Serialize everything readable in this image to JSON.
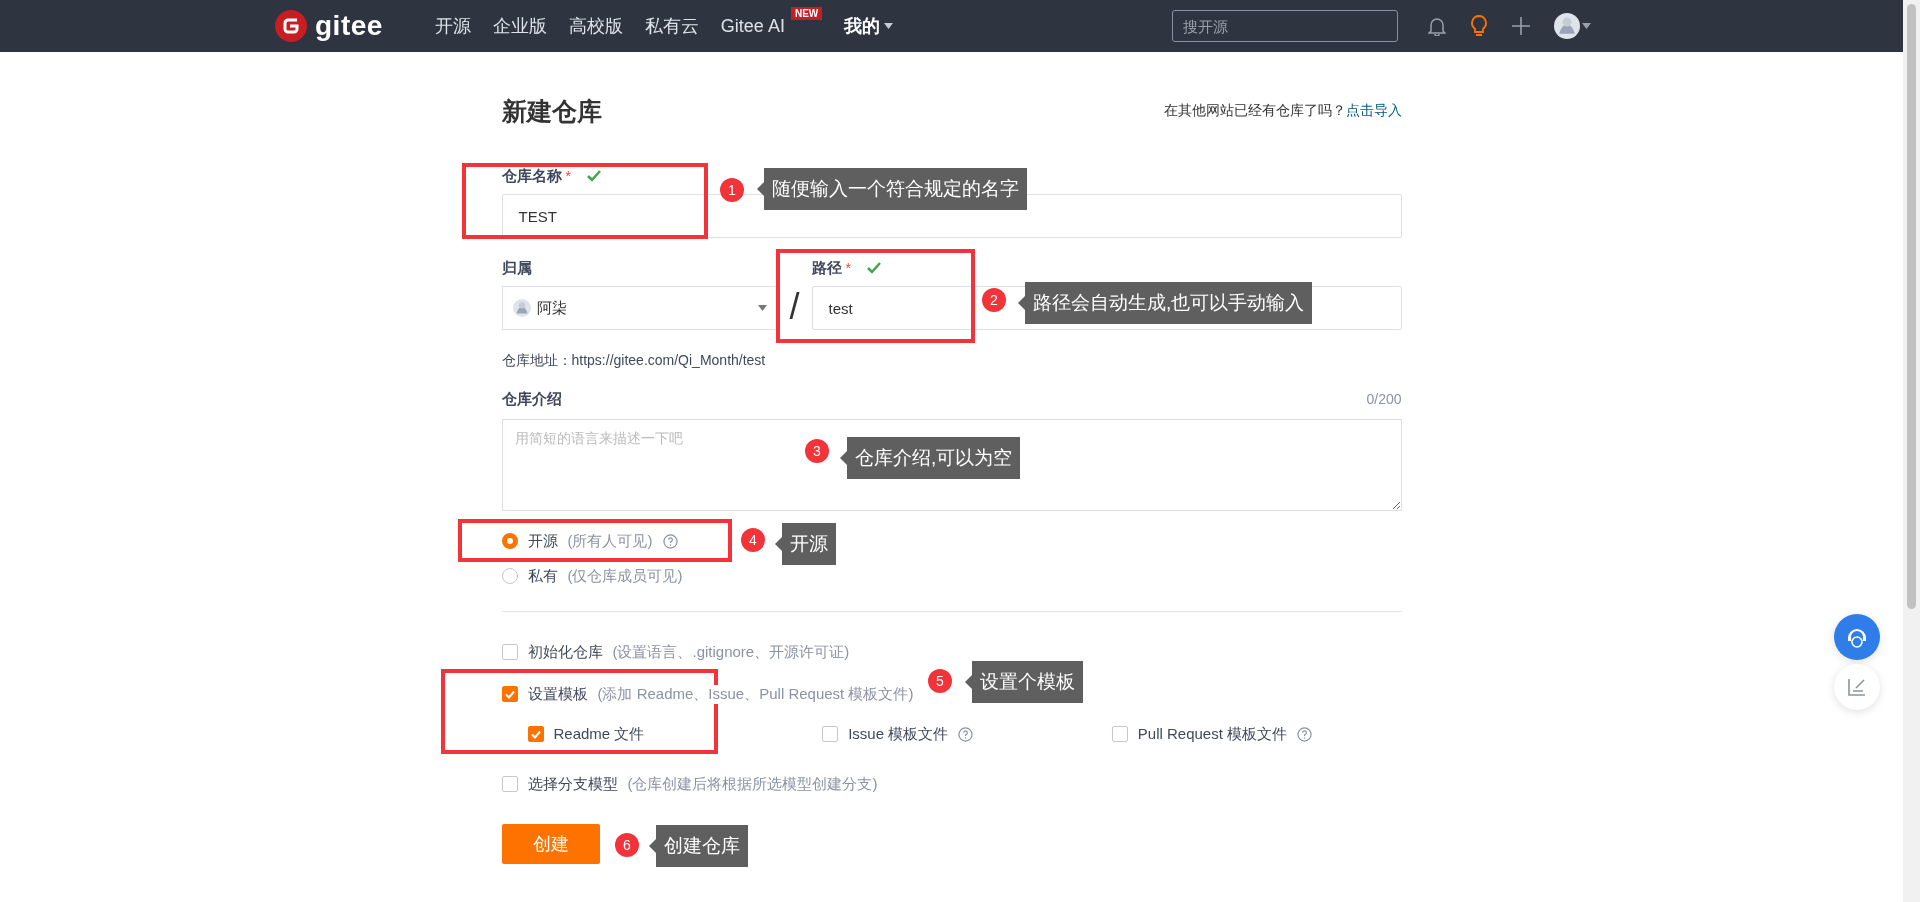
{
  "header": {
    "logo_text": "gitee",
    "nav": [
      {
        "label": "开源",
        "kind": "link"
      },
      {
        "label": "企业版",
        "kind": "link"
      },
      {
        "label": "高校版",
        "kind": "link"
      },
      {
        "label": "私有云",
        "kind": "link"
      },
      {
        "label": "Gitee AI",
        "kind": "link",
        "badge": "NEW"
      },
      {
        "label": "我的",
        "kind": "dropdown"
      }
    ],
    "search": {
      "placeholder": "搜开源"
    }
  },
  "page": {
    "title": "新建仓库",
    "import_prompt": "在其他网站已经有仓库了吗？",
    "import_link": "点击导入"
  },
  "form": {
    "name": {
      "label": "仓库名称",
      "required": "*",
      "valid": true,
      "value": "TEST"
    },
    "owner": {
      "label": "归属",
      "value": "阿柒"
    },
    "separator": "/",
    "path": {
      "label": "路径",
      "required": "*",
      "valid": true,
      "value": "test"
    },
    "address": "仓库地址：https://gitee.com/Qi_Month/test",
    "description": {
      "label": "仓库介绍",
      "counter": "0/200",
      "placeholder": "用简短的语言来描述一下吧"
    },
    "visibility": [
      {
        "label": "开源",
        "hint": "(所有人可见)",
        "selected": true,
        "help_icon": true
      },
      {
        "label": "私有",
        "hint": "(仅仓库成员可见)",
        "selected": false,
        "help_icon": false
      }
    ],
    "options": [
      {
        "label": "初始化仓库",
        "hint": "(设置语言、.gitignore、开源许可证)",
        "checked": false
      },
      {
        "label": "设置模板",
        "hint": "(添加 Readme、Issue、Pull Request 模板文件)",
        "checked": true,
        "children": [
          {
            "label": "Readme 文件",
            "checked": true,
            "help_icon": false
          },
          {
            "label": "Issue 模板文件",
            "checked": false,
            "help_icon": true
          },
          {
            "label": "Pull Request 模板文件",
            "checked": false,
            "help_icon": true
          }
        ]
      },
      {
        "label": "选择分支模型",
        "hint": "(仓库创建后将根据所选模型创建分支)",
        "checked": false
      }
    ],
    "submit": "创建"
  },
  "annotations": [
    {
      "number": "1",
      "text": "随便输入一个符合规定的名字"
    },
    {
      "number": "2",
      "text": "路径会自动生成,也可以手动输入"
    },
    {
      "number": "3",
      "text": "仓库介绍,可以为空"
    },
    {
      "number": "4",
      "text": "开源"
    },
    {
      "number": "5",
      "text": "设置个模板"
    },
    {
      "number": "6",
      "text": "创建仓库"
    }
  ]
}
